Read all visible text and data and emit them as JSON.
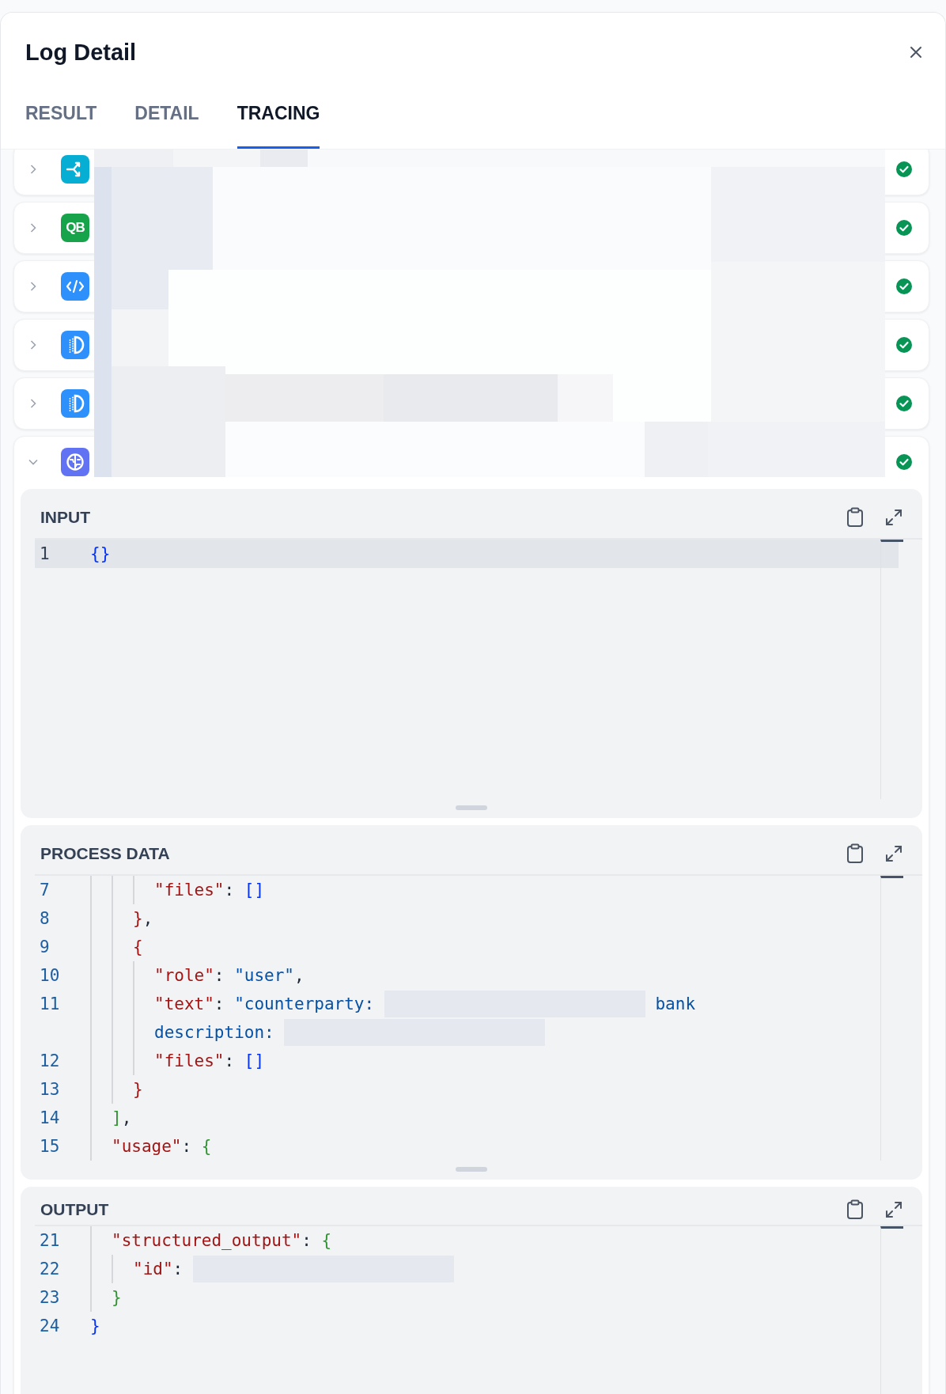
{
  "title": "Log Detail",
  "tabs": [
    {
      "label": "RESULT",
      "selected": false
    },
    {
      "label": "DETAIL",
      "selected": false
    },
    {
      "label": "TRACING",
      "selected": true
    }
  ],
  "nodes": [
    {
      "kind": "branch",
      "expanded": false,
      "succeeded": true
    },
    {
      "kind": "badge",
      "badge_text": "QB",
      "expanded": false,
      "succeeded": true
    },
    {
      "kind": "code",
      "expanded": false,
      "succeeded": true
    },
    {
      "kind": "retrieval",
      "expanded": false,
      "succeeded": true
    },
    {
      "kind": "retrieval",
      "expanded": false,
      "succeeded": true
    },
    {
      "kind": "llm",
      "expanded": true,
      "succeeded": true
    }
  ],
  "panels": [
    {
      "title": "INPUT",
      "lines": [
        {
          "number": "1",
          "active": true,
          "tokens": [
            {
              "kind": "bracket",
              "text": "{}",
              "color": "#0431fa"
            }
          ]
        }
      ]
    },
    {
      "title": "PROCESS DATA",
      "lines": [
        {
          "children": [
            {
              "children": [
                {
                  "children": [
                    {
                      "number": "7",
                      "active": false,
                      "tokens": [
                        {
                          "kind": "key",
                          "text": "\"files\""
                        },
                        {
                          "kind": "punct",
                          "text": ": "
                        },
                        {
                          "kind": "bracket",
                          "text": "[]",
                          "color": "#0431fa"
                        }
                      ]
                    }
                  ]
                },
                {
                  "number": "8",
                  "active": false,
                  "tokens": [
                    {
                      "kind": "bracket",
                      "text": "}",
                      "color": "#a31515"
                    },
                    {
                      "kind": "punct",
                      "text": ","
                    }
                  ]
                },
                {
                  "number": "9",
                  "active": false,
                  "tokens": [
                    {
                      "kind": "bracket",
                      "text": "{",
                      "color": "#a31515"
                    }
                  ]
                },
                {
                  "children": [
                    {
                      "number": "10",
                      "active": false,
                      "tokens": [
                        {
                          "kind": "key",
                          "text": "\"role\""
                        },
                        {
                          "kind": "punct",
                          "text": ": "
                        },
                        {
                          "kind": "string",
                          "text": "\"user\""
                        },
                        {
                          "kind": "punct",
                          "text": ","
                        }
                      ]
                    },
                    {
                      "number": "11",
                      "active": false,
                      "tokens": [
                        {
                          "kind": "key",
                          "text": "\"text\""
                        },
                        {
                          "kind": "punct",
                          "text": ": "
                        },
                        {
                          "kind": "string",
                          "text": "\"counterparty: "
                        },
                        {
                          "kind": "redacted"
                        },
                        {
                          "kind": "string",
                          "text": " bank"
                        }
                      ]
                    },
                    {
                      "active": false,
                      "tokens": [
                        {
                          "kind": "string",
                          "text": "description: "
                        },
                        {
                          "kind": "redacted"
                        }
                      ]
                    },
                    {
                      "number": "12",
                      "active": false,
                      "tokens": [
                        {
                          "kind": "key",
                          "text": "\"files\""
                        },
                        {
                          "kind": "punct",
                          "text": ": "
                        },
                        {
                          "kind": "bracket",
                          "text": "[]",
                          "color": "#0431fa"
                        }
                      ]
                    }
                  ]
                },
                {
                  "number": "13",
                  "active": false,
                  "tokens": [
                    {
                      "kind": "bracket",
                      "text": "}",
                      "color": "#a31515"
                    }
                  ]
                }
              ]
            },
            {
              "number": "14",
              "active": false,
              "tokens": [
                {
                  "kind": "bracket",
                  "text": "]",
                  "color": "#319331"
                },
                {
                  "kind": "punct",
                  "text": ","
                }
              ]
            },
            {
              "number": "15",
              "active": false,
              "tokens": [
                {
                  "kind": "key",
                  "text": "\"usage\""
                },
                {
                  "kind": "punct",
                  "text": ": "
                },
                {
                  "kind": "bracket",
                  "text": "{",
                  "color": "#319331"
                }
              ]
            }
          ]
        }
      ]
    },
    {
      "title": "OUTPUT",
      "lines": [
        {
          "children": [
            {
              "number": "21",
              "active": false,
              "tokens": [
                {
                  "kind": "key",
                  "text": "\"structured_output\""
                },
                {
                  "kind": "punct",
                  "text": ": "
                },
                {
                  "kind": "bracket",
                  "text": "{",
                  "color": "#319331"
                }
              ]
            },
            {
              "children": [
                {
                  "number": "22",
                  "active": false,
                  "tokens": [
                    {
                      "kind": "key",
                      "text": "\"id\""
                    },
                    {
                      "kind": "punct",
                      "text": ": "
                    },
                    {
                      "kind": "redacted"
                    }
                  ]
                }
              ]
            },
            {
              "number": "23",
              "active": false,
              "tokens": [
                {
                  "kind": "bracket",
                  "text": "}",
                  "color": "#319331"
                }
              ]
            }
          ]
        },
        {
          "number": "24",
          "active": false,
          "tokens": [
            {
              "kind": "bracket",
              "text": "}",
              "color": "#0431fa"
            }
          ]
        }
      ]
    }
  ]
}
